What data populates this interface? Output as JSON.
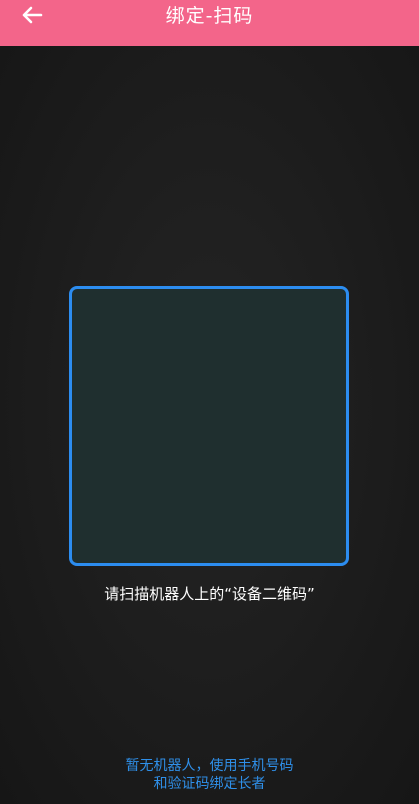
{
  "header": {
    "title": "绑定-扫码",
    "back_icon": "arrow-left-icon",
    "background_color": "#f3658a"
  },
  "scanner": {
    "frame_color": "#2c8df0",
    "hint": "请扫描机器人上的“设备二维码”"
  },
  "footer": {
    "line1": "暂无机器人，使用手机号码",
    "line2": "和验证码绑定长者",
    "link_color": "#2f8fe8"
  }
}
